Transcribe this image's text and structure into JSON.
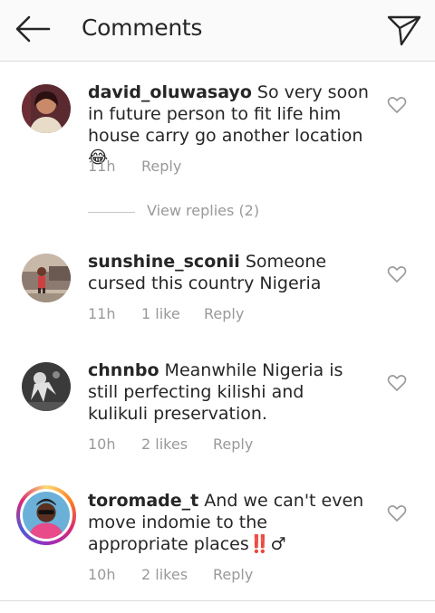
{
  "header": {
    "title": "Comments",
    "back_icon": "arrow-left-icon",
    "send_icon": "paper-plane-icon"
  },
  "comments": [
    {
      "username": "david_oluwasayo",
      "text": "So very soon in future person to fit life him house carry go another location",
      "emoji": "😂",
      "time": "11h",
      "likes": "",
      "reply": "Reply"
    },
    {
      "username": "sunshine_sconii",
      "text": "Someone cursed this country Nigeria",
      "time": "11h",
      "likes": "1 like",
      "reply": "Reply"
    },
    {
      "username": "chnnbo",
      "text": "Meanwhile Nigeria is still perfecting kilishi and kulikuli preservation.",
      "time": "10h",
      "likes": "2 likes",
      "reply": "Reply"
    },
    {
      "username": "toromade_t",
      "text": "And we can't even move indomie to the appropriate places",
      "suffix": "‼️♂",
      "time": "10h",
      "likes": "2 likes",
      "reply": "Reply"
    }
  ],
  "view_replies": "View replies (2)",
  "colors": {
    "text": "#262626",
    "muted": "#999999",
    "divider": "#dbdbdb"
  }
}
